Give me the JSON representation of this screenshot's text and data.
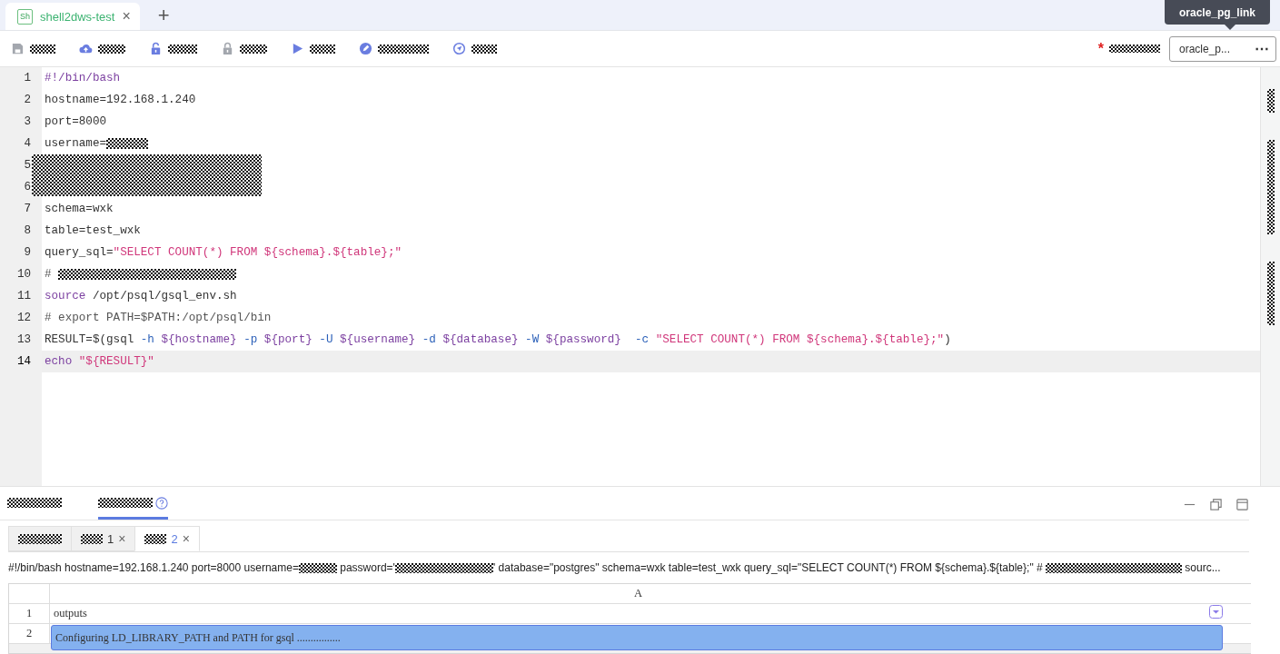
{
  "file_tabs": [
    {
      "icon_text": "Sh",
      "label": "shell2dws-test",
      "close": "×",
      "selected": true
    }
  ],
  "new_tab": "+",
  "tooltip": "oracle_pg_link",
  "toolbar": [
    {
      "disabled": true
    },
    {
      "disabled": false
    },
    {
      "disabled": false
    },
    {
      "disabled": true
    },
    {
      "disabled": false
    },
    {
      "disabled": false
    },
    {
      "disabled": false
    }
  ],
  "connection": {
    "required_mark": "*",
    "select_value": "oracle_p...",
    "more": "⋯"
  },
  "editor": {
    "lines": [
      {
        "number": "1",
        "current": false,
        "tokens": [
          {
            "kind": "keyword",
            "text": "#!/bin/bash"
          }
        ]
      },
      {
        "number": "2",
        "current": false,
        "tokens": [
          {
            "kind": "plain",
            "text": "hostname=192.168.1.240"
          }
        ]
      },
      {
        "number": "3",
        "current": false,
        "tokens": [
          {
            "kind": "plain",
            "text": "port=8000"
          }
        ]
      },
      {
        "number": "4",
        "current": false,
        "tokens": [
          {
            "kind": "plain",
            "text": "username="
          },
          {
            "kind": "redacted"
          }
        ]
      },
      {
        "number": "5",
        "current": false
      },
      {
        "number": "6",
        "current": false
      },
      {
        "number": "7",
        "current": false,
        "tokens": [
          {
            "kind": "plain",
            "text": "schema=wxk"
          }
        ]
      },
      {
        "number": "8",
        "current": false,
        "tokens": [
          {
            "kind": "plain",
            "text": "table=test_wxk"
          }
        ]
      },
      {
        "number": "9",
        "current": false,
        "tokens": [
          {
            "kind": "plain",
            "text": "query_sql="
          },
          {
            "kind": "string",
            "text": "\"SELECT COUNT(*) FROM ${schema}.${table};\""
          }
        ]
      },
      {
        "number": "10",
        "current": false,
        "tokens": [
          {
            "kind": "comment",
            "text": "# "
          },
          {
            "kind": "redacted"
          }
        ]
      },
      {
        "number": "11",
        "current": false,
        "tokens": [
          {
            "kind": "keyword",
            "text": "source"
          },
          {
            "kind": "plain",
            "text": " /opt/psql/gsql_env.sh"
          }
        ]
      },
      {
        "number": "12",
        "current": false,
        "tokens": [
          {
            "kind": "comment",
            "text": "# export PATH=$PATH:/opt/psql/bin"
          }
        ]
      },
      {
        "number": "13",
        "current": false,
        "tokens": [
          {
            "kind": "plain",
            "text": "RESULT=$(gsql "
          },
          {
            "kind": "option",
            "text": "-h"
          },
          {
            "kind": "var",
            "text": " ${hostname} "
          },
          {
            "kind": "option",
            "text": "-p"
          },
          {
            "kind": "var",
            "text": " ${port} "
          },
          {
            "kind": "option",
            "text": "-U"
          },
          {
            "kind": "var",
            "text": " ${username} "
          },
          {
            "kind": "option",
            "text": "-d"
          },
          {
            "kind": "var",
            "text": " ${database} "
          },
          {
            "kind": "option",
            "text": "-W"
          },
          {
            "kind": "var",
            "text": " ${password}  "
          },
          {
            "kind": "option",
            "text": "-c"
          },
          {
            "kind": "string",
            "text": " \"SELECT COUNT(*) FROM ${schema}.${table};\""
          },
          {
            "kind": "plain",
            "text": ")"
          }
        ]
      },
      {
        "number": "14",
        "current": true,
        "tokens": [
          {
            "kind": "keyword",
            "text": "echo"
          },
          {
            "kind": "string",
            "text": " \"${RESULT}\""
          }
        ]
      }
    ]
  },
  "panel": {
    "tabs": [
      {
        "help": false,
        "selected": false
      },
      {
        "help": true,
        "selected": true
      }
    ],
    "result_tabs": [
      {
        "closable": false,
        "selected": false
      },
      {
        "suffix": "1",
        "closable": true,
        "selected": false
      },
      {
        "suffix": "2",
        "closable": true,
        "selected": true
      }
    ],
    "close_mark": "×",
    "script_text": [
      {
        "kind": "text",
        "text": "#!/bin/bash hostname=192.168.1.240 port=8000 username="
      },
      {
        "kind": "redacted"
      },
      {
        "kind": "text",
        "text": " password='"
      },
      {
        "kind": "redacted"
      },
      {
        "kind": "text",
        "text": "' database=\"postgres\" schema=wxk table=test_wxk query_sql=\"SELECT COUNT(*) FROM ${schema}.${table};\" # "
      },
      {
        "kind": "redacted"
      },
      {
        "kind": "text",
        "text": " sourc..."
      }
    ],
    "sheet": {
      "column": "A",
      "rows": [
        {
          "number": "1",
          "value": "outputs",
          "selected": false
        },
        {
          "number": "2",
          "value": "Configuring LD_LIBRARY_PATH and PATH for gsql ................",
          "selected": true
        }
      ]
    }
  }
}
